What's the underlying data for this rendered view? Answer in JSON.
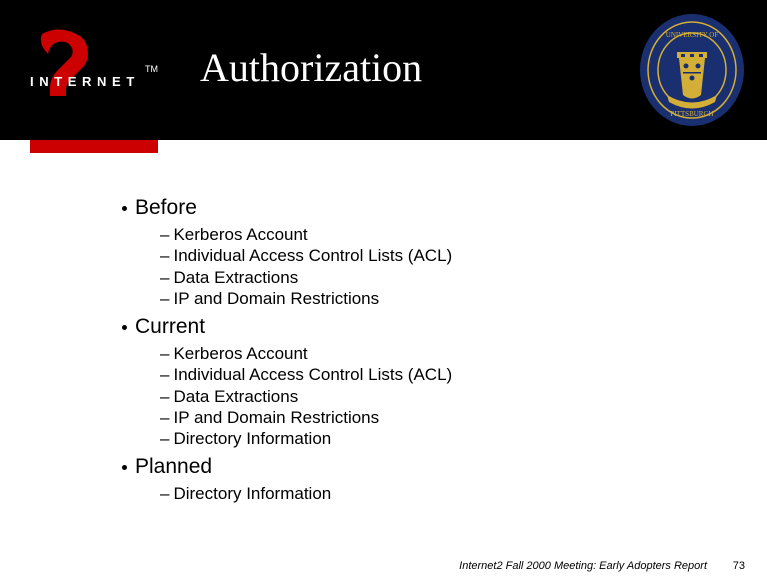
{
  "title": "Authorization",
  "sections": [
    {
      "label": "Before",
      "items": [
        "Kerberos Account",
        "Individual Access Control Lists (ACL)",
        "Data Extractions",
        "IP and Domain Restrictions"
      ]
    },
    {
      "label": "Current",
      "items": [
        "Kerberos Account",
        "Individual Access Control Lists (ACL)",
        "Data Extractions",
        "IP and Domain Restrictions",
        "Directory Information"
      ]
    },
    {
      "label": "Planned",
      "items": [
        "Directory Information"
      ]
    }
  ],
  "footer": "Internet2 Fall 2000 Meeting: Early Adopters Report",
  "page": "73",
  "logos": {
    "left_alt": "Internet2",
    "right_alt": "University of Pittsburgh Seal"
  }
}
